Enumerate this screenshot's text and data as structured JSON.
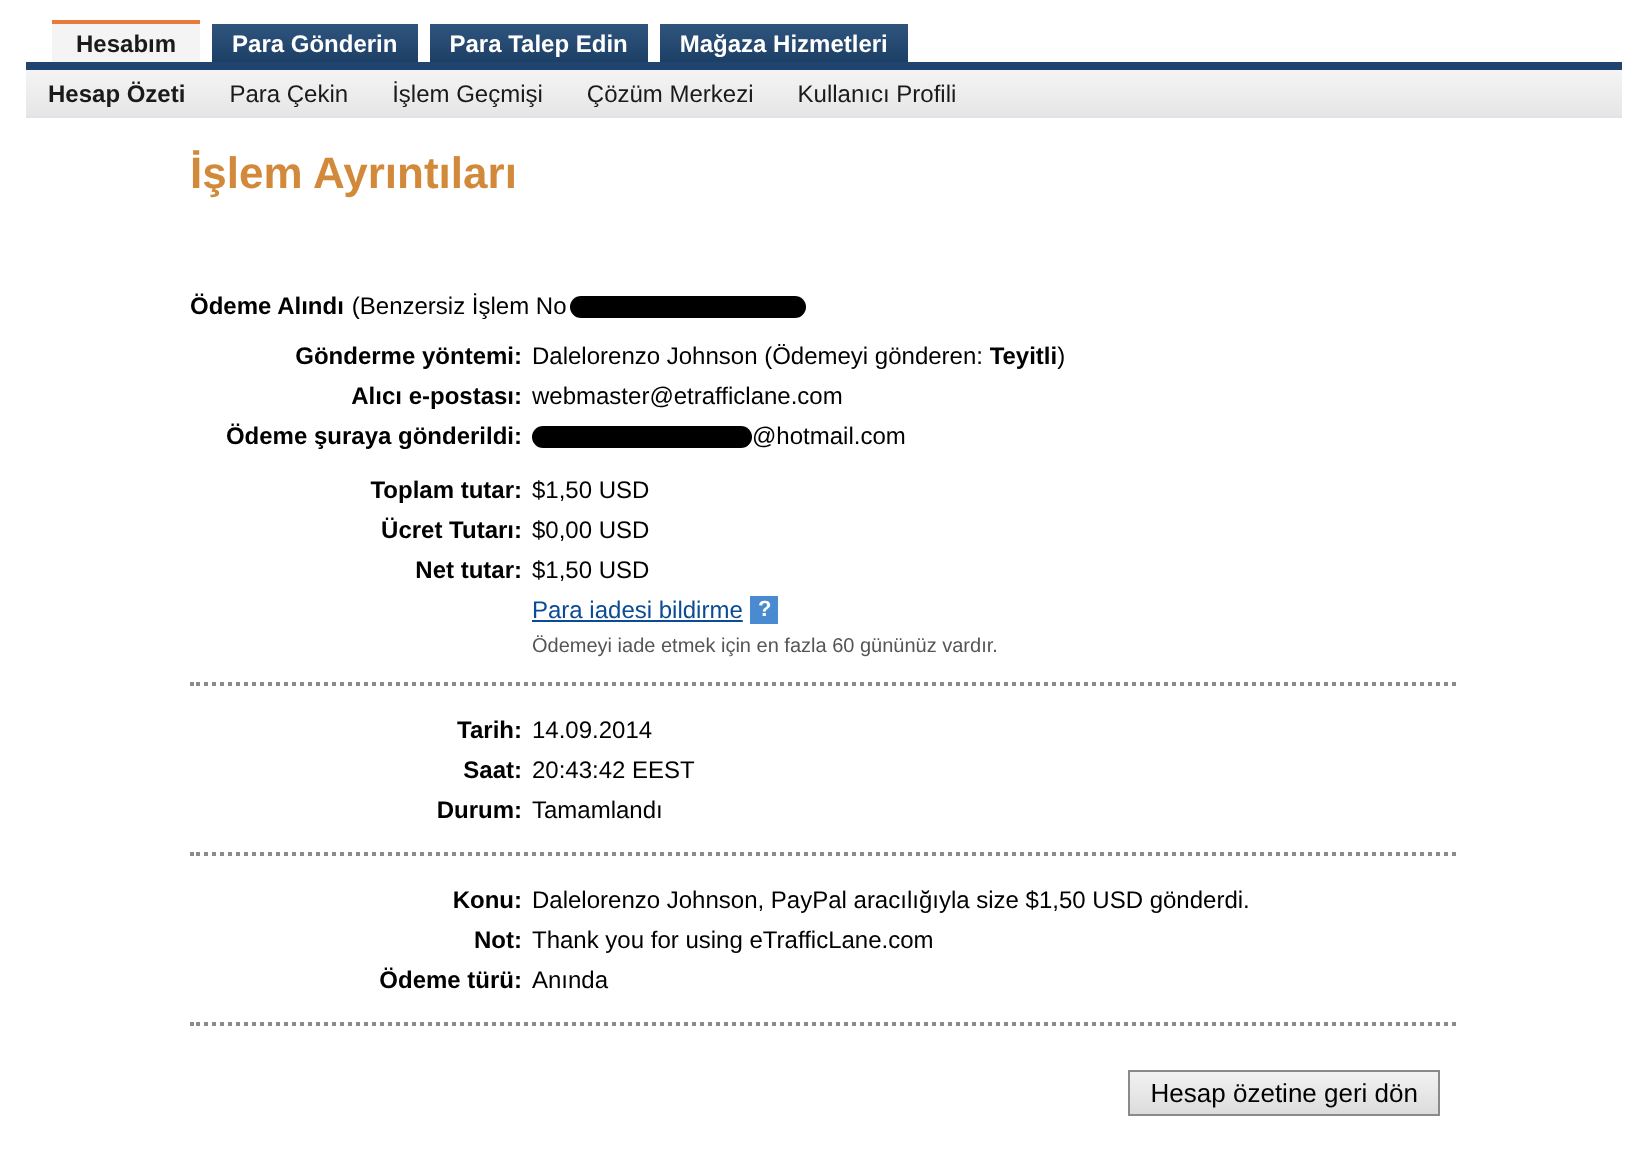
{
  "tabs": [
    {
      "label": "Hesabım",
      "selected": true
    },
    {
      "label": "Para Gönderin",
      "selected": false
    },
    {
      "label": "Para Talep Edin",
      "selected": false
    },
    {
      "label": "Mağaza Hizmetleri",
      "selected": false
    }
  ],
  "subnav": [
    {
      "label": "Hesap Özeti",
      "selected": true
    },
    {
      "label": "Para Çekin",
      "selected": false
    },
    {
      "label": "İşlem Geçmişi",
      "selected": false
    },
    {
      "label": "Çözüm Merkezi",
      "selected": false
    },
    {
      "label": "Kullanıcı Profili",
      "selected": false
    }
  ],
  "title": "İşlem Ayrıntıları",
  "receipt": {
    "label": "Ödeme Alındı",
    "text": "(Benzersiz İşlem No",
    "redacted": true
  },
  "sections": [
    {
      "blocks": [
        {
          "rows": [
            {
              "label": "Gönderme yöntemi:",
              "value": "Dalelorenzo Johnson (Ödemeyi gönderen: **Teyitli**)"
            },
            {
              "label": "Alıcı e-postası:",
              "value": "webmaster@etrafficlane.com"
            },
            {
              "label": "Ödeme şuraya gönderildi:",
              "value": "@hotmail.com",
              "redacted": true
            }
          ]
        },
        {
          "rows": [
            {
              "label": "Toplam tutar:",
              "value": "$1,50 USD"
            },
            {
              "label": "Ücret Tutarı:",
              "value": "$0,00 USD"
            },
            {
              "label": "Net tutar:",
              "value": "$1,50 USD"
            }
          ],
          "refund": {
            "link": "Para iadesi bildirme",
            "help": "?",
            "note": "Ödemeyi iade etmek için en fazla 60 gününüz vardır."
          }
        }
      ]
    },
    {
      "blocks": [
        {
          "rows": [
            {
              "label": "Tarih:",
              "value": "14.09.2014"
            },
            {
              "label": "Saat:",
              "value": "20:43:42 EEST"
            },
            {
              "label": "Durum:",
              "value": "Tamamlandı"
            }
          ]
        }
      ]
    },
    {
      "blocks": [
        {
          "rows": [
            {
              "label": "Konu:",
              "value": "Dalelorenzo Johnson, PayPal aracılığıyla size $1,50 USD gönderdi."
            },
            {
              "label": "Not:",
              "value": "Thank you for using eTrafficLane.com"
            },
            {
              "label": "Ödeme türü:",
              "value": "Anında"
            }
          ]
        }
      ]
    }
  ],
  "back_button": "Hesap özetine geri dön"
}
